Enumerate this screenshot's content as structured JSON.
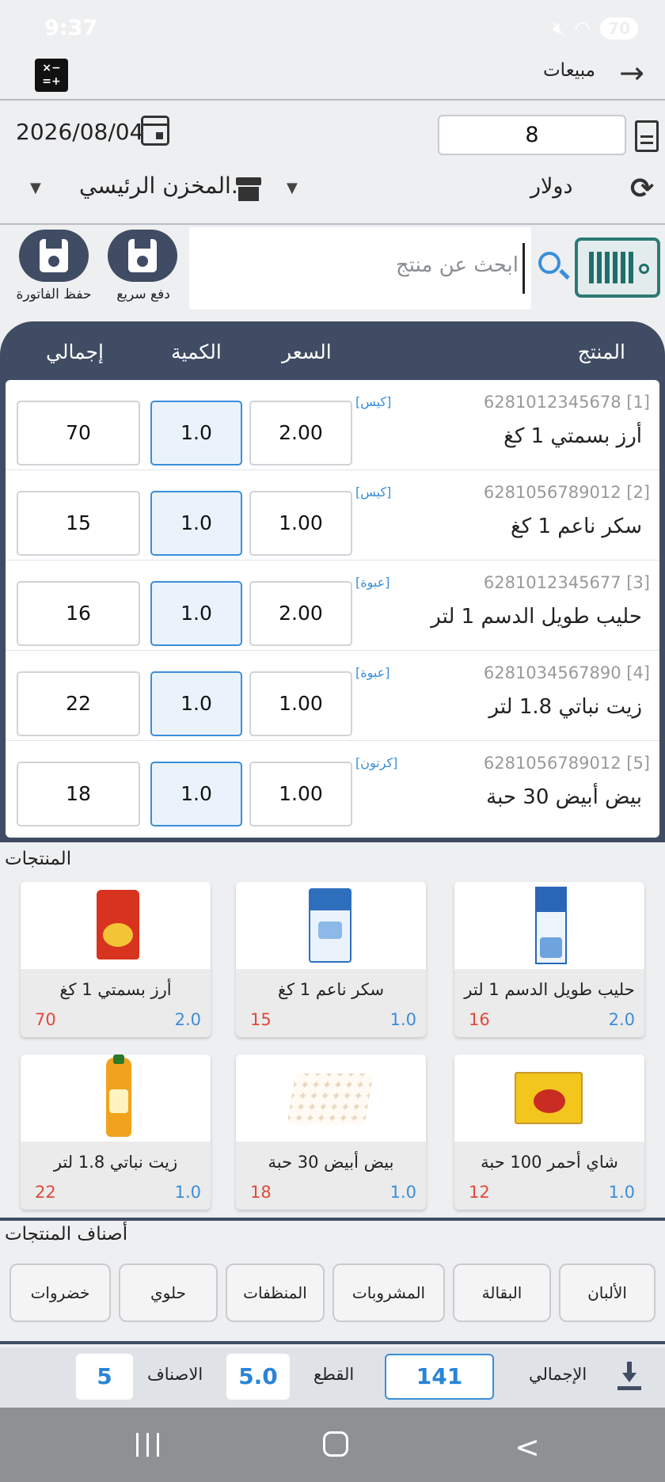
{
  "status_bar": {
    "time": "9:37",
    "battery": "70"
  },
  "header": {
    "title": "مبيعات"
  },
  "invoice": {
    "date": "2026/08/04",
    "number": "8",
    "currency": "دولار",
    "warehouse": "المخزن الرئيسي."
  },
  "search": {
    "placeholder": "ابحث عن منتج"
  },
  "actions": {
    "quick_pay": "دفع سريع",
    "save_invoice": "حفظ الفاتورة"
  },
  "table": {
    "headers": {
      "product": "المنتج",
      "price": "السعر",
      "quantity": "الكمية",
      "total": "إجمالي"
    },
    "rows": [
      {
        "index": "[1]",
        "code": "6281012345678",
        "unit": "[كيس]",
        "name": "أرز بسمتي 1 كغ",
        "price": "2.00",
        "qty": "1.0",
        "total": "70"
      },
      {
        "index": "[2]",
        "code": "6281056789012",
        "unit": "[كيس]",
        "name": "سكر ناعم 1 كغ",
        "price": "1.00",
        "qty": "1.0",
        "total": "15"
      },
      {
        "index": "[3]",
        "code": "6281012345677",
        "unit": "[عبوة]",
        "name": "حليب طويل الدسم 1 لتر",
        "price": "2.00",
        "qty": "1.0",
        "total": "16"
      },
      {
        "index": "[4]",
        "code": "6281034567890",
        "unit": "[عبوة]",
        "name": "زيت نباتي 1.8 لتر",
        "price": "1.00",
        "qty": "1.0",
        "total": "22"
      },
      {
        "index": "[5]",
        "code": "6281056789012",
        "unit": "[كرتون]",
        "name": "بيض أبيض 30 حبة",
        "price": "1.00",
        "qty": "1.0",
        "total": "18"
      }
    ]
  },
  "products": {
    "title": "المنتجات",
    "items": [
      {
        "name": "أرز بسمتي 1 كغ",
        "qty": "70",
        "price": "2.0",
        "image": "chips-bag"
      },
      {
        "name": "سكر ناعم 1 كغ",
        "qty": "15",
        "price": "1.0",
        "image": "sugar-bag"
      },
      {
        "name": "حليب طويل الدسم 1 لتر",
        "qty": "16",
        "price": "2.0",
        "image": "milk-carton"
      },
      {
        "name": "زيت نباتي 1.8 لتر",
        "qty": "22",
        "price": "1.0",
        "image": "oil-bottle"
      },
      {
        "name": "بيض أبيض 30 حبة",
        "qty": "18",
        "price": "1.0",
        "image": "egg-tray"
      },
      {
        "name": "شاي أحمر 100 حبة",
        "qty": "12",
        "price": "1.0",
        "image": "tea-box"
      }
    ]
  },
  "categories": {
    "title": "أصناف المنتجات",
    "items": [
      "الألبان",
      "البقالة",
      "المشروبات",
      "المنظفات",
      "حلوي",
      "خضروات"
    ]
  },
  "footer": {
    "total_label": "الإجمالي",
    "total_value": "141",
    "pieces_label": "القطع",
    "pieces_value": "5.0",
    "categories_label": "الاصناف",
    "categories_value": "5"
  },
  "colors": {
    "primary": "#3f4c63",
    "accent": "#3a8ed8",
    "qty_red": "#e04a3a",
    "barcode_teal": "#2c7a76"
  },
  "icons": [
    "calculator-icon",
    "back-arrow-icon",
    "calendar-icon",
    "document-icon",
    "store-icon",
    "sync-currency-icon",
    "save-icon",
    "search-icon",
    "barcode-scanner-icon",
    "download-icon"
  ]
}
